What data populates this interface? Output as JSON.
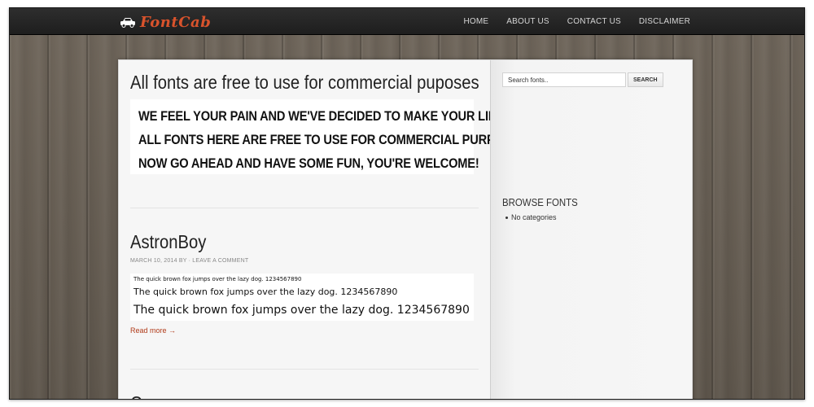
{
  "header": {
    "logo_text": "FontCab",
    "logo_icon": "car-icon",
    "nav": [
      {
        "label": "HOME"
      },
      {
        "label": "ABOUT US"
      },
      {
        "label": "CONTACT US"
      },
      {
        "label": "DISCLAIMER"
      }
    ]
  },
  "posts": [
    {
      "title": "All fonts are free to use for commercial puposes",
      "banner_lines": [
        "WE FEEL YOUR PAIN AND WE'VE DECIDED TO MAKE YOUR LIFE EASY",
        "ALL FONTS HERE ARE FREE TO USE FOR COMMERCIAL PURPOSES...",
        "NOW GO AHEAD AND HAVE SOME FUN, YOU'RE WELCOME!"
      ]
    },
    {
      "title": "AstronBoy",
      "meta_date": "MARCH 10, 2014",
      "meta_by": "BY",
      "meta_sep": "·",
      "meta_comment": "LEAVE A COMMENT",
      "sample_lines": [
        "The quick brown fox jumps over the lazy dog. 1234567890",
        "The quick brown fox jumps over the lazy dog. 1234567890",
        "The quick brown fox jumps over the lazy dog. 1234567890"
      ],
      "read_more": "Read more →"
    },
    {
      "title": "Cr... "
    }
  ],
  "sidebar": {
    "search_placeholder": "Search fonts..",
    "search_button": "SEARCH",
    "widget_title": "BROWSE FONTS",
    "categories": [
      "No categories"
    ]
  },
  "colors": {
    "accent": "#d9532c",
    "link": "#b03a18",
    "topbar": "#262626"
  }
}
